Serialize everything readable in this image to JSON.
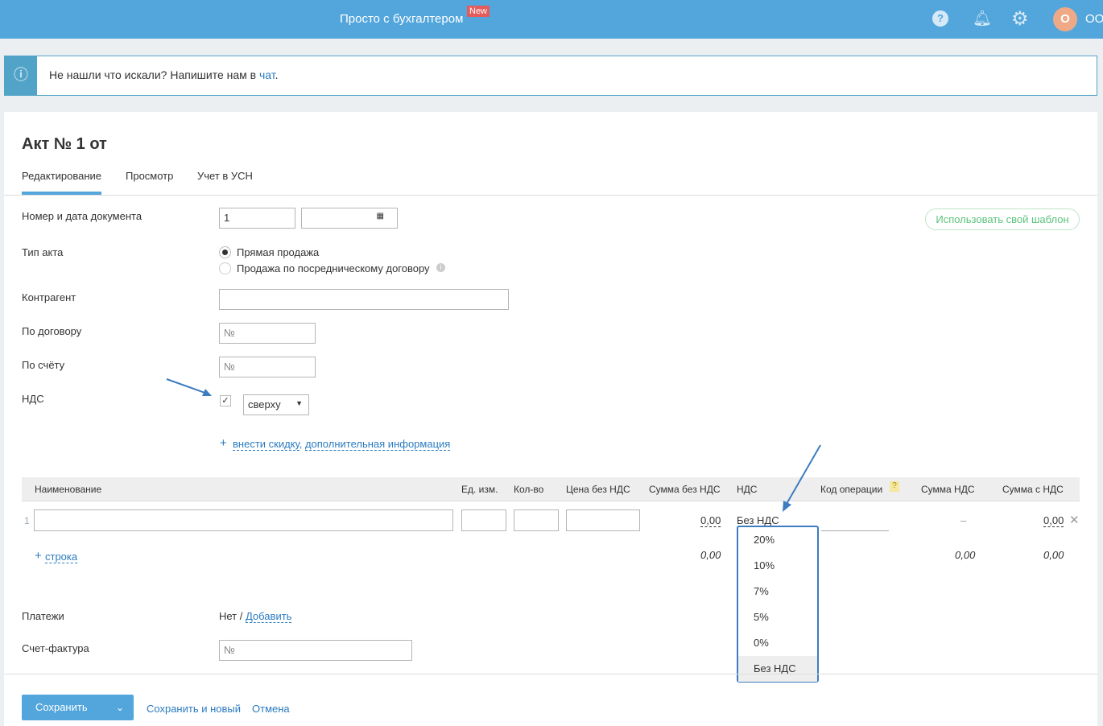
{
  "header": {
    "title": "Просто с бухгалтером",
    "badge": "New",
    "avatar": "О",
    "user": "ОО"
  },
  "notice": {
    "text": "Не нашли что искали? Напишите нам в ",
    "link": "чат",
    "end": "."
  },
  "page": {
    "title": "Акт № 1 от"
  },
  "tabs": [
    "Редактирование",
    "Просмотр",
    "Учет в УСН"
  ],
  "form": {
    "doc_label": "Номер и дата документа",
    "doc_number": "1",
    "template_button": "Использовать свой шаблон",
    "type_label": "Тип акта",
    "type_options": [
      "Прямая продажа",
      "Продажа по посредническому договору"
    ],
    "counterparty_label": "Контрагент",
    "contract_label": "По договору",
    "contract_placeholder": "№",
    "invoice_label": "По счёту",
    "invoice_placeholder": "№",
    "vat_label": "НДС",
    "vat_mode": "сверху",
    "discount_link": "внести скидку",
    "extra_link": "дополнительная информация",
    "payments_label": "Платежи",
    "payments_value": "Нет / ",
    "payments_add": "Добавить",
    "sf_label": "Счет-фактура",
    "sf_placeholder": "№"
  },
  "table": {
    "headers": [
      "Наименование",
      "Ед. изм.",
      "Кол-во",
      "Цена без НДС",
      "Сумма без НДС",
      "НДС",
      "Код операции",
      "Сумма НДС",
      "Сумма с НДС"
    ],
    "row": {
      "index": "1",
      "sum_no_vat": "0,00",
      "vat": "Без НДС",
      "vat_sum": "–",
      "total": "0,00"
    },
    "add_row": "строка",
    "totals": {
      "sum_no_vat": "0,00",
      "vat_sum": "0,00",
      "total": "0,00"
    },
    "help": "?"
  },
  "dropdown": {
    "options": [
      "20%",
      "10%",
      "7%",
      "5%",
      "0%",
      "Без НДС"
    ],
    "selected": "Без НДС"
  },
  "footer": {
    "save": "Сохранить",
    "save_new": "Сохранить и новый",
    "cancel": "Отмена"
  }
}
